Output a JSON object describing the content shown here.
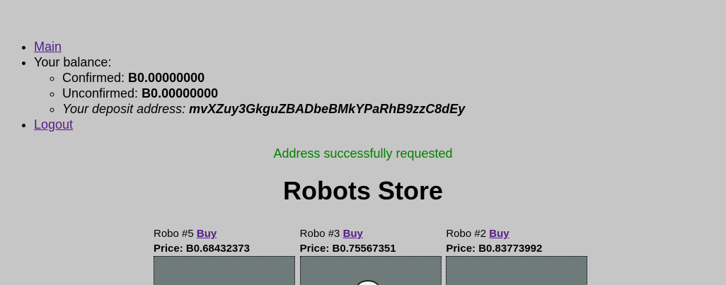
{
  "nav": {
    "main_link": "Main",
    "balance_label": "Your balance:",
    "confirmed_label": "Confirmed:",
    "confirmed_value": "B0.00000000",
    "unconfirmed_label": "Unconfirmed:",
    "unconfirmed_value": "B0.00000000",
    "deposit_label": "Your deposit address:",
    "deposit_address": "mvXZuy3GkguZBADbeBMkYPaRhB9zzC8dEy",
    "logout_link": "Logout"
  },
  "flash_message": "Address successfully requested",
  "store_title": "Robots Store",
  "buy_label": "Buy",
  "products": [
    {
      "name": "Robo #5",
      "price": "Price: B0.68432373"
    },
    {
      "name": "Robo #3",
      "price": "Price: B0.75567351"
    },
    {
      "name": "Robo #2",
      "price": "Price: B0.83773992"
    }
  ],
  "colors": {
    "background": "#c6c6c6",
    "link": "#551a8b",
    "success": "#008000",
    "image_bg": "#6f7b7a"
  }
}
